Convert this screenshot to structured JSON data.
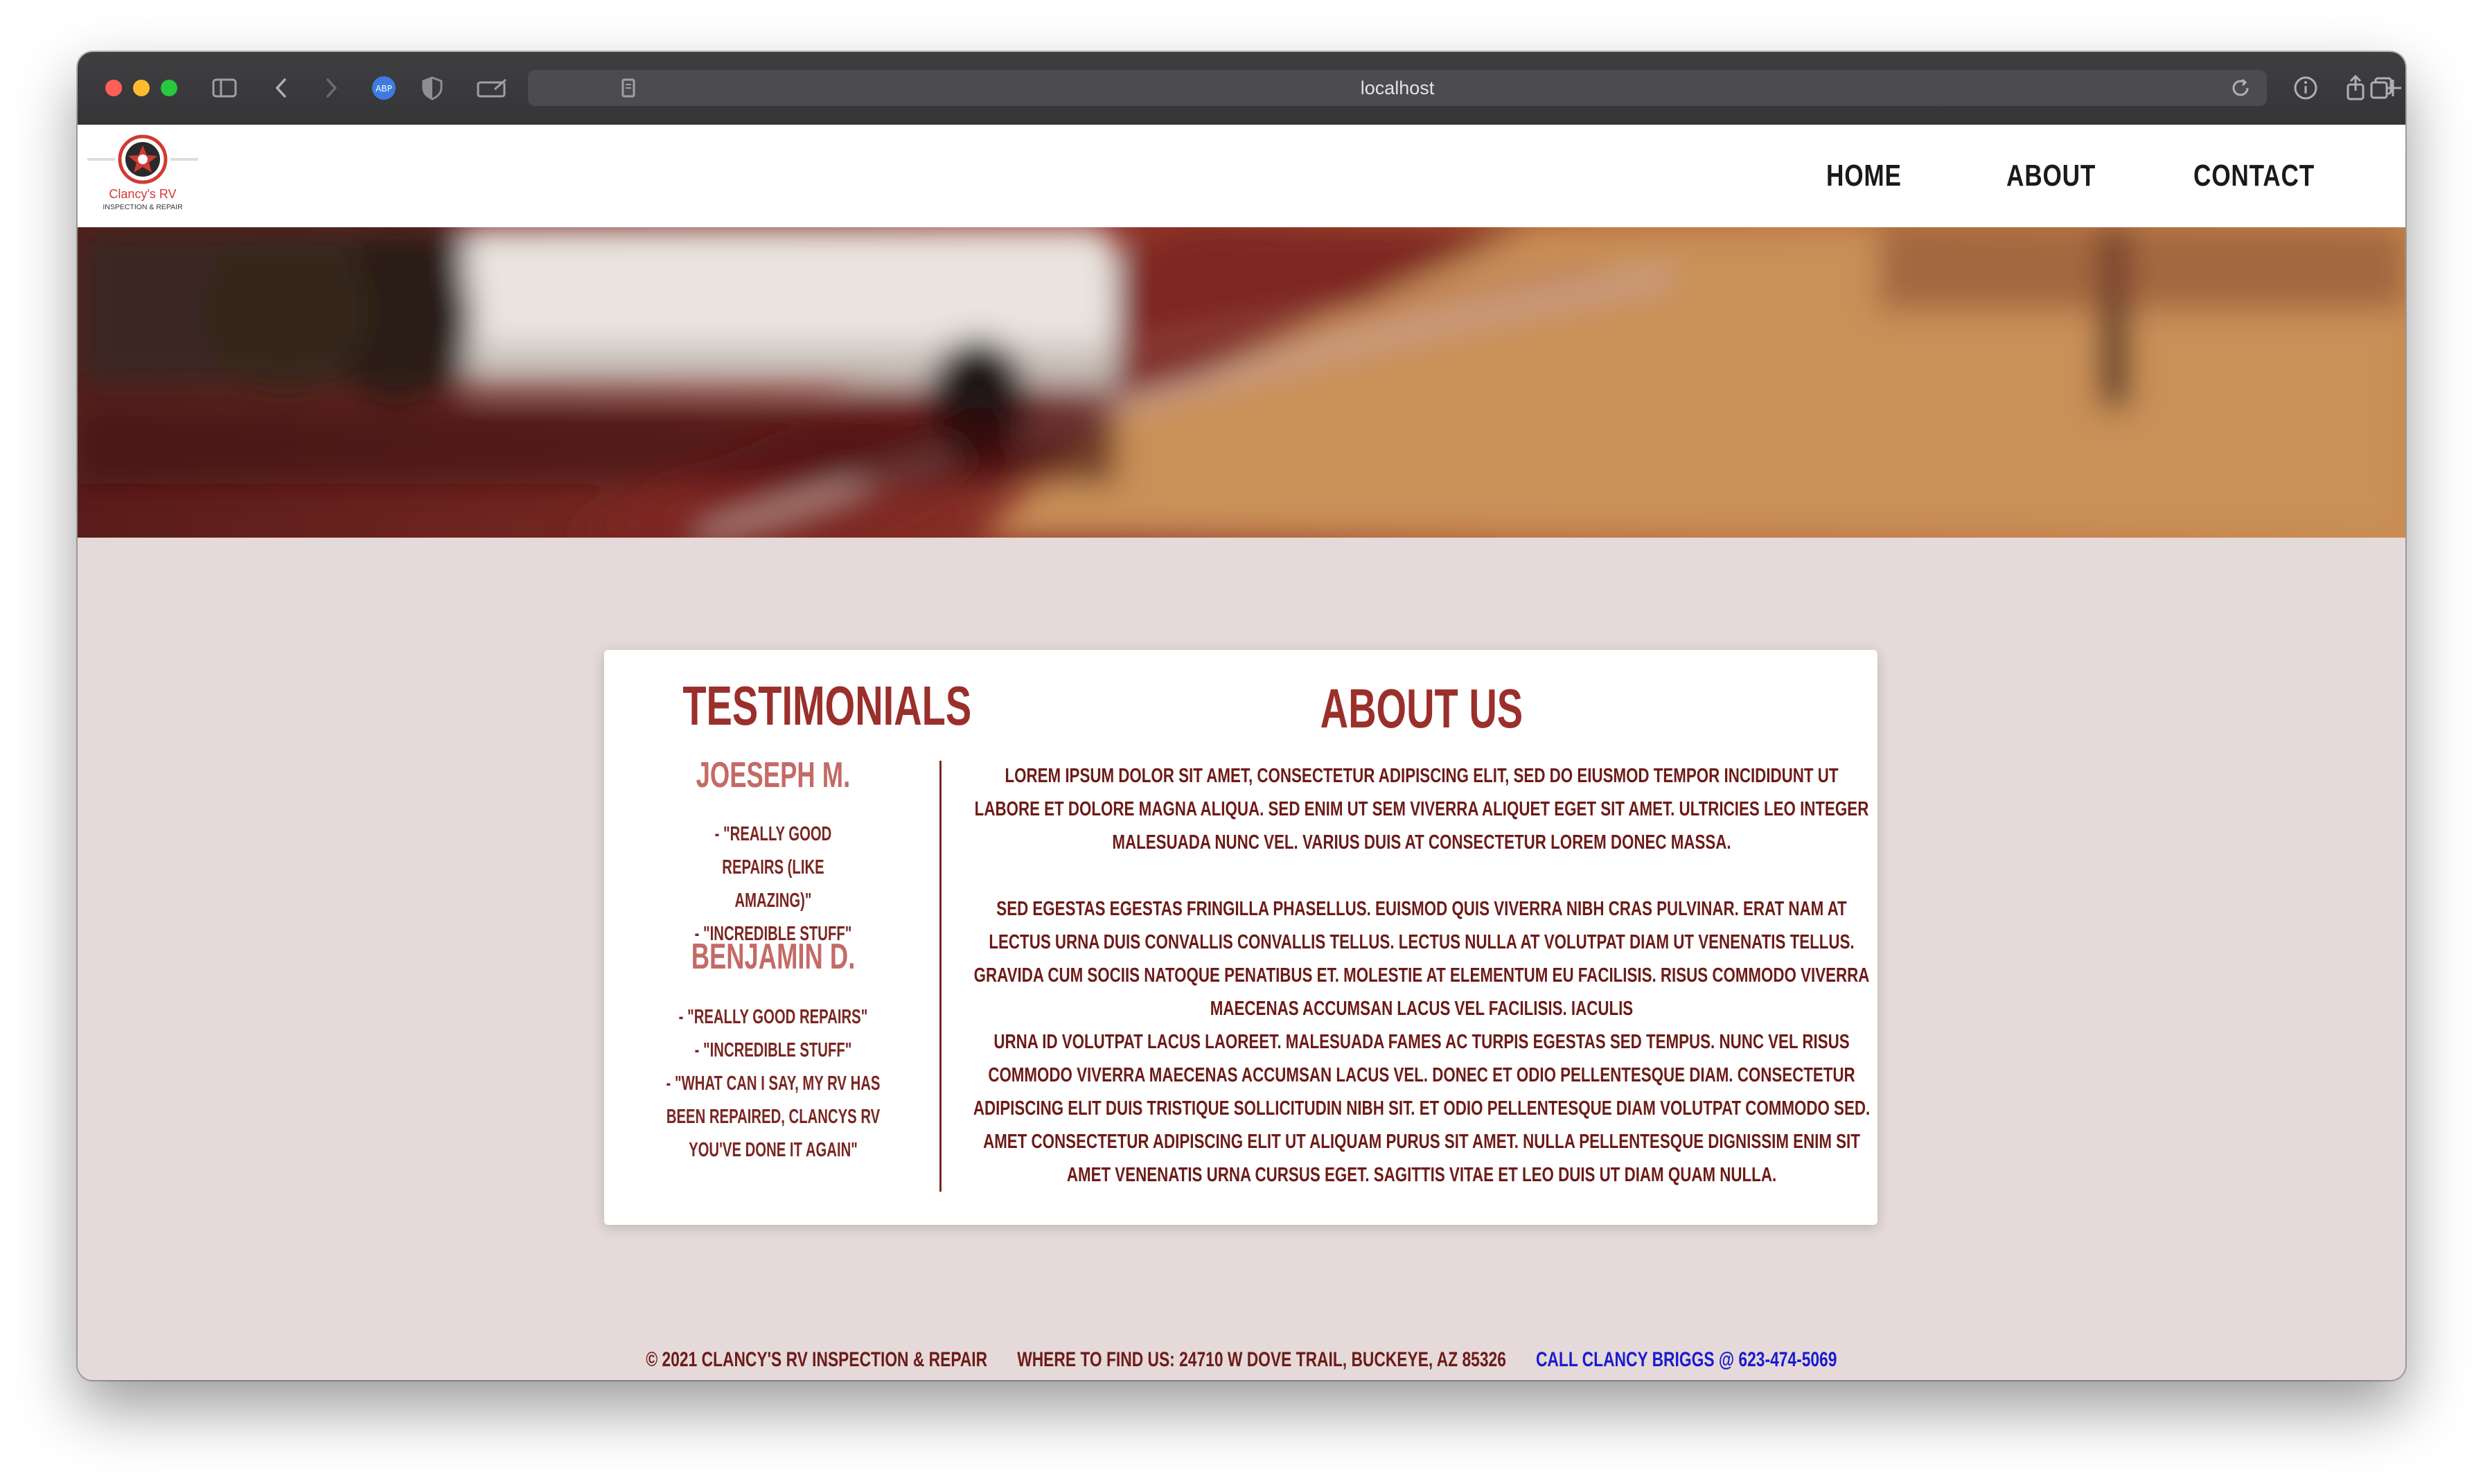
{
  "browser": {
    "url": "localhost",
    "colors": {
      "close": "#ff5f57",
      "minimize": "#febc2e",
      "maximize": "#28c840"
    }
  },
  "logo": {
    "line1": "Clancy's RV",
    "line2": "INSPECTION & REPAIR"
  },
  "nav": {
    "items": [
      "HOME",
      "ABOUT",
      "CONTACT"
    ]
  },
  "testimonials": {
    "heading": "TESTIMONIALS",
    "people": [
      {
        "name": "JOESEPH M.",
        "quotes": [
          "- \"REALLY GOOD REPAIRS (LIKE AMAZING)\"",
          "- \"INCREDIBLE STUFF\""
        ]
      },
      {
        "name": "BENJAMIN D.",
        "quotes": [
          "- \"REALLY GOOD REPAIRS\"",
          "- \"INCREDIBLE STUFF\"",
          "- \"WHAT CAN I SAY, MY RV HAS BEEN REPAIRED, CLANCYS RV YOU'VE DONE IT AGAIN\""
        ]
      }
    ]
  },
  "about": {
    "heading": "ABOUT US",
    "paragraphs": [
      "LOREM IPSUM DOLOR SIT AMET, CONSECTETUR ADIPISCING ELIT, SED DO EIUSMOD TEMPOR INCIDIDUNT UT LABORE ET DOLORE MAGNA ALIQUA. SED ENIM UT SEM VIVERRA ALIQUET EGET SIT AMET. ULTRICIES LEO INTEGER MALESUADA NUNC VEL. VARIUS DUIS AT CONSECTETUR LOREM DONEC MASSA.",
      "SED EGESTAS EGESTAS FRINGILLA PHASELLUS. EUISMOD QUIS VIVERRA NIBH CRAS PULVINAR. ERAT NAM AT LECTUS URNA DUIS CONVALLIS CONVALLIS TELLUS. LECTUS NULLA AT VOLUTPAT DIAM UT VENENATIS TELLUS. GRAVIDA CUM SOCIIS NATOQUE PENATIBUS ET. MOLESTIE AT ELEMENTUM EU FACILISIS. RISUS COMMODO VIVERRA MAECENAS ACCUMSAN LACUS VEL FACILISIS. IACULIS",
      "URNA ID VOLUTPAT LACUS LAOREET. MALESUADA FAMES AC TURPIS EGESTAS SED TEMPUS. NUNC VEL RISUS COMMODO VIVERRA MAECENAS ACCUMSAN LACUS VEL. DONEC ET ODIO PELLENTESQUE DIAM. CONSECTETUR ADIPISCING ELIT DUIS TRISTIQUE SOLLICITUDIN NIBH SIT. ET ODIO PELLENTESQUE DIAM VOLUTPAT COMMODO SED. AMET CONSECTETUR ADIPISCING ELIT UT ALIQUAM PURUS SIT AMET. NULLA PELLENTESQUE DIGNISSIM ENIM SIT AMET VENENATIS URNA CURSUS EGET. SAGITTIS VITAE ET LEO DUIS UT DIAM QUAM NULLA."
    ]
  },
  "footer": {
    "copyright": "© 2021 CLANCY'S RV INSPECTION & REPAIR",
    "address": "WHERE TO FIND US: 24710 W DOVE TRAIL, BUCKEYE, AZ 85326",
    "call": "CALL CLANCY BRIGGS @ 623-474-5069"
  }
}
